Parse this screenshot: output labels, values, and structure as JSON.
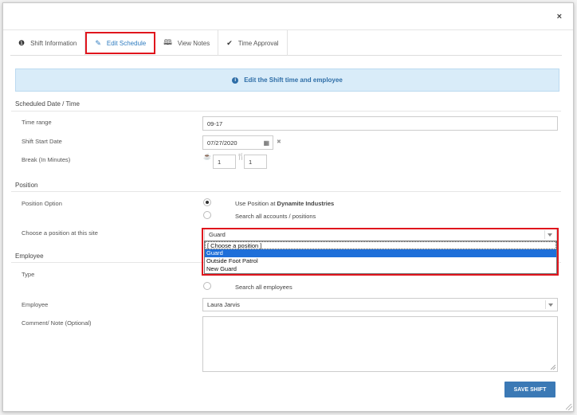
{
  "modal": {
    "close_glyph": "×"
  },
  "tabs": [
    {
      "label": "Shift Information",
      "icon": "info-circle-icon",
      "glyph": "❶"
    },
    {
      "label": "Edit Schedule",
      "icon": "pencil-icon",
      "glyph": "✎"
    },
    {
      "label": "View Notes",
      "icon": "book-icon",
      "glyph": "🕮"
    },
    {
      "label": "Time Approval",
      "icon": "check-icon",
      "glyph": "✔"
    }
  ],
  "banner": {
    "text": "Edit the Shift time and employee",
    "glyph": "i"
  },
  "scheduled": {
    "title": "Scheduled Date / Time",
    "time_range_label": "Time range",
    "time_range_value": "09-17",
    "start_date_label": "Shift Start Date",
    "start_date_value": "07/27/2020",
    "calendar_glyph": "▦",
    "clear_glyph": "✖",
    "break_label": "Break (In Minutes)",
    "break_meal_glyph": "☕",
    "break_meal_value": "1",
    "break_rest_glyph": "🍴",
    "break_rest_value": "1"
  },
  "position": {
    "title": "Position",
    "option_label": "Position Option",
    "option_use_prefix": "Use Position at ",
    "option_use_company": "Dynamite Industries",
    "option_search": "Search all accounts / positions",
    "choose_label": "Choose a position at this site",
    "selected": "Guard",
    "options": [
      "[ Choose a position ]",
      "Guard",
      "Outside Foot Patrol",
      "New Guard"
    ]
  },
  "employee": {
    "title": "Employee",
    "type_label": "Type",
    "search_all": "Search all employees",
    "employee_label": "Employee",
    "employee_value": "Laura Jarvis",
    "comment_label": "Comment/ Note (Optional)"
  },
  "actions": {
    "save_label": "SAVE SHIFT"
  }
}
